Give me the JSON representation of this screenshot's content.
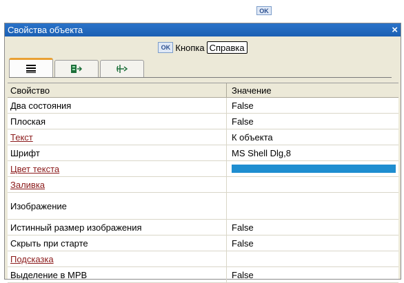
{
  "top": {
    "ok_label": "OK"
  },
  "window": {
    "title": "Свойства объекта",
    "close_glyph": "×",
    "object_label": "Кнопка",
    "ok_label": "OK",
    "help_label": "Справка"
  },
  "tabs": [
    {
      "icon": "property-list-icon"
    },
    {
      "icon": "events-icon"
    },
    {
      "icon": "layout-icon"
    }
  ],
  "grid": {
    "headers": {
      "property": "Свойство",
      "value": "Значение"
    },
    "rows": [
      {
        "property": "Два состояния",
        "value": "False"
      },
      {
        "property": "Плоская",
        "value": "False"
      },
      {
        "property": "Текст",
        "value": "К объекта"
      },
      {
        "property": "Шрифт",
        "value": "MS Shell Dlg,8"
      },
      {
        "property": "Цвет текста",
        "value": ""
      },
      {
        "property": "Заливка",
        "value": ""
      },
      {
        "property": "Изображение",
        "value": ""
      },
      {
        "property": "Истинный размер изображения",
        "value": "False"
      },
      {
        "property": "Скрыть при старте",
        "value": "False"
      },
      {
        "property": "Подсказка",
        "value": ""
      },
      {
        "property": "Выделение в МРВ",
        "value": "False"
      }
    ],
    "text_color_value": "#1f8ed0"
  }
}
